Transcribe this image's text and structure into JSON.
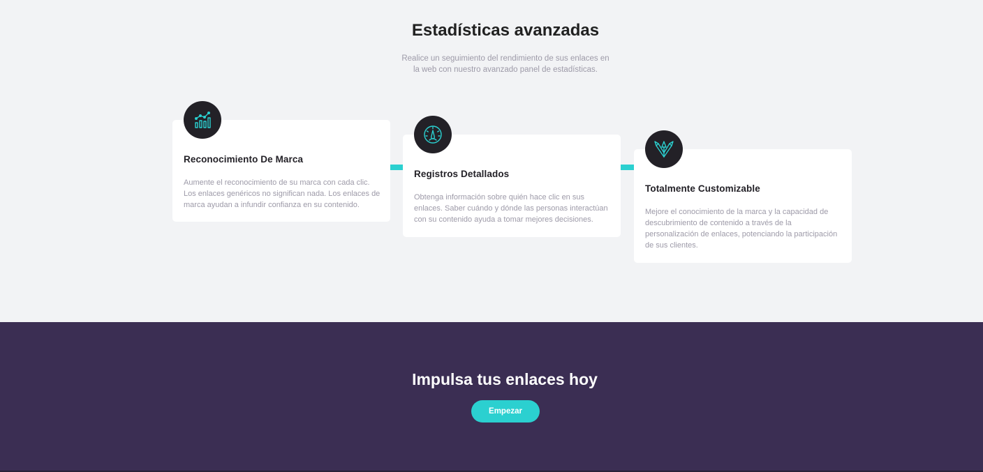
{
  "stats": {
    "title": "Estadísticas avanzadas",
    "subtitle": "Realice un seguimiento del rendimiento de sus enlaces en la web con nuestro avanzado panel de estadísticas."
  },
  "cards": [
    {
      "icon": "brand-recognition-chart-icon",
      "title": "Reconocimiento De Marca",
      "text": "Aumente el reconocimiento de su marca con cada clic. Los enlaces genéricos no significan nada. Los enlaces de marca ayudan a infundir confianza en su contenido."
    },
    {
      "icon": "speedometer-gauge-icon",
      "title": "Registros Detallados",
      "text": "Obtenga información sobre quién hace clic en sus enlaces. Saber cuándo y dónde las personas interactúan con su contenido ayuda a tomar mejores decisiones."
    },
    {
      "icon": "design-tools-brush-pen-icon",
      "title": "Totalmente Customizable",
      "text": "Mejore el conocimiento de la marca y la capacidad de descubrimiento de contenido a través de la personalización de enlaces, potenciando la participación de sus clientes."
    }
  ],
  "cta": {
    "title": "Impulsa tus enlaces hoy",
    "button_label": "Empezar"
  },
  "colors": {
    "accent": "#2bd0d0",
    "dark_violet": "#3b2e53",
    "icon_bg": "#232127",
    "heading": "#232127",
    "muted_text": "#9d9aa8",
    "section_bg": "#f2f3f5"
  }
}
